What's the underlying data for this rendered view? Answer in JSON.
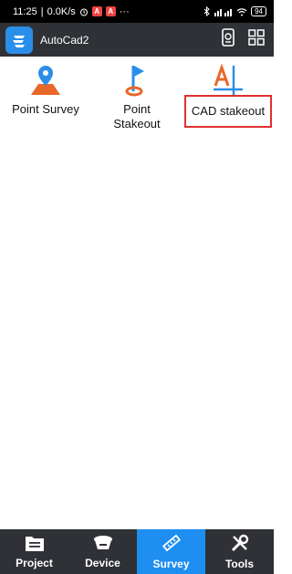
{
  "status_bar": {
    "time": "11:25",
    "network_speed": "0.0K/s",
    "battery": "94"
  },
  "app_bar": {
    "title": "AutoCad2"
  },
  "survey_items": [
    {
      "label": "Point Survey"
    },
    {
      "label": "Point\nStakeout"
    },
    {
      "label": "CAD stakeout"
    }
  ],
  "bottom_nav": [
    {
      "label": "Project",
      "icon": "project-icon"
    },
    {
      "label": "Device",
      "icon": "device-icon"
    },
    {
      "label": "Survey",
      "icon": "survey-icon",
      "active": true
    },
    {
      "label": "Tools",
      "icon": "tools-icon"
    }
  ],
  "colors": {
    "bar_background": "#2f3136",
    "accent": "#1e8ef0",
    "highlight_box": "#e03030",
    "icon_orange": "#e8672a",
    "icon_blue": "#2b8ee8"
  }
}
